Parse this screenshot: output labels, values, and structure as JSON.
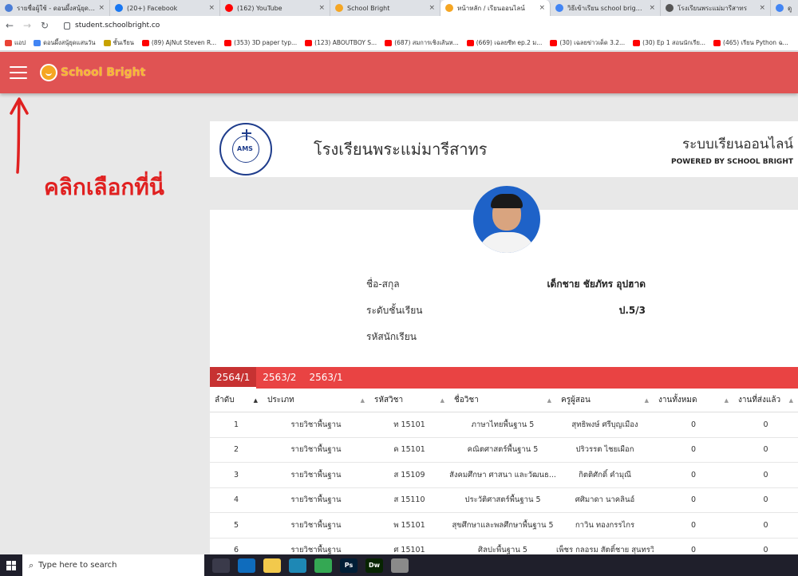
{
  "browser": {
    "tabs": [
      {
        "title": "รายชื่อผู้ใช้ - ดอนผึ้งสนุ้ยุดแสนวัน",
        "color": "#4a7dd6",
        "active": false
      },
      {
        "title": "(20+) Facebook",
        "color": "#1877f2",
        "active": false
      },
      {
        "title": "(162) YouTube",
        "color": "#ff0000",
        "active": false
      },
      {
        "title": "School Bright",
        "color": "#f5a623",
        "active": false
      },
      {
        "title": "หน้าหลัก / เรียนออนไลน์",
        "color": "#f5a623",
        "active": true
      },
      {
        "title": "วิธีเข้าเรียน school bright - G",
        "color": "#4285f4",
        "active": false
      },
      {
        "title": "โรงเรียนพระแม่มารีสาทร",
        "color": "#555555",
        "active": false
      },
      {
        "title": "ดู",
        "color": "#4285f4",
        "active": false
      }
    ],
    "url": "student.schoolbright.co",
    "bookmarks": [
      {
        "label": "แอป",
        "color": "#ea4335"
      },
      {
        "label": "ดอนผึ้งสนุ้ยุดแสนวัน",
        "color": "#4285f4"
      },
      {
        "label": "ชั้นเรียน",
        "color": "#c8a200"
      },
      {
        "label": "(89) AjNut Steven R...",
        "color": "#ff0000"
      },
      {
        "label": "(353) 3D paper typ...",
        "color": "#ff0000"
      },
      {
        "label": "(123) ABOUTBOY S...",
        "color": "#ff0000"
      },
      {
        "label": "(687) สมการเชิงเส้นห...",
        "color": "#ff0000"
      },
      {
        "label": "(669) เฉลยซีท ep.2 ม...",
        "color": "#ff0000"
      },
      {
        "label": "(30) เฉลยข่าวเด็ด 3.2...",
        "color": "#ff0000"
      },
      {
        "label": "(30) Ep 1 สอนนักเรีย...",
        "color": "#ff0000"
      },
      {
        "label": "(465) เรียน Python ฉ...",
        "color": "#ff0000"
      }
    ]
  },
  "app": {
    "brand": "School Bright",
    "accent": "#e05353"
  },
  "annotation": {
    "text": "คลิกเลือกที่นี่"
  },
  "school": {
    "name": "โรงเรียนพระแม่มารีสาทร",
    "system_title": "ระบบเรียนออนไลน์",
    "powered_by": "POWERED BY SCHOOL BRIGHT",
    "seal_letters": "AMS"
  },
  "student": {
    "rows": [
      {
        "label": "ชื่อ-สกุล",
        "value": "เด็กชาย ชัยภัทร อุปฮาด"
      },
      {
        "label": "ระดับชั้นเรียน",
        "value": "ป.5/3"
      },
      {
        "label": "รหัสนักเรียน",
        "value": ""
      }
    ]
  },
  "semesters": [
    "2564/1",
    "2563/2",
    "2563/1"
  ],
  "table": {
    "headers": [
      "ลำดับ",
      "ประเภท",
      "รหัสวิชา",
      "ชื่อวิชา",
      "ครูผู้สอน",
      "งานทั้งหมด",
      "งานที่ส่งแล้ว"
    ],
    "rows": [
      [
        "1",
        "รายวิชาพื้นฐาน",
        "ท 15101",
        "ภาษาไทยพื้นฐาน 5",
        "สุทธิพงษ์ ศรีบุญเมือง",
        "0",
        "0"
      ],
      [
        "2",
        "รายวิชาพื้นฐาน",
        "ค 15101",
        "คณิตศาสตร์พื้นฐาน 5",
        "ปริวรรต ไชยเผือก",
        "0",
        "0"
      ],
      [
        "3",
        "รายวิชาพื้นฐาน",
        "ส 15109",
        "สังคมศึกษา ศาสนา และวัฒนธ...",
        "กิตติศักดิ์ คำมุณี",
        "0",
        "0"
      ],
      [
        "4",
        "รายวิชาพื้นฐาน",
        "ส 15110",
        "ประวัติศาสตร์พื้นฐาน 5",
        "ศศิมาดา นาคลินอ์",
        "0",
        "0"
      ],
      [
        "5",
        "รายวิชาพื้นฐาน",
        "พ 15101",
        "สุขศึกษาและพลศึกษาพื้นฐาน 5",
        "กาวิน ทองกรรไกร",
        "0",
        "0"
      ],
      [
        "6",
        "รายวิชาพื้นฐาน",
        "ศ 15101",
        "ศิลปะพื้นฐาน 5",
        "เพ็ชร กลอรม สัตติ์ชาย สุนทรวิ",
        "0",
        "0"
      ]
    ]
  },
  "taskbar": {
    "search_placeholder": "Type here to search",
    "apps": [
      {
        "name": "task-view",
        "label": "",
        "color": "#3a3a4a"
      },
      {
        "name": "mail",
        "label": "",
        "color": "#0f6cbd"
      },
      {
        "name": "folder",
        "label": "",
        "color": "#f2c94c"
      },
      {
        "name": "edge",
        "label": "",
        "color": "#1e88b5"
      },
      {
        "name": "chrome",
        "label": "",
        "color": "#34a853"
      },
      {
        "name": "photoshop",
        "label": "Ps",
        "color": "#001e36"
      },
      {
        "name": "dreamweaver",
        "label": "Dw",
        "color": "#072401"
      },
      {
        "name": "app",
        "label": "",
        "color": "#8a8a8a"
      }
    ]
  }
}
